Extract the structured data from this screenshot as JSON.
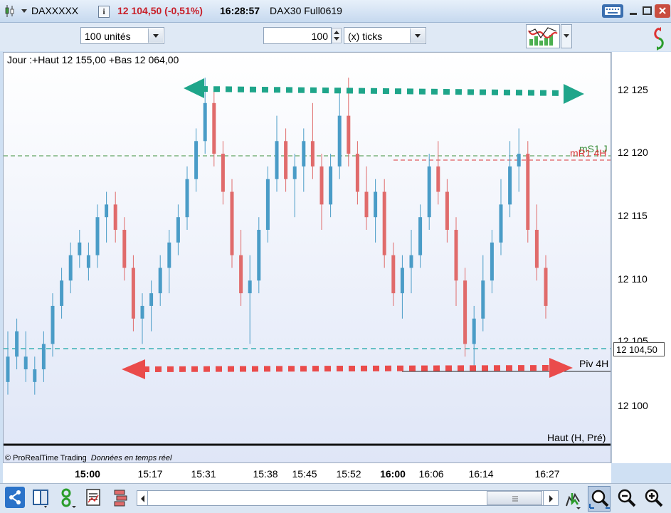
{
  "titlebar": {
    "symbol": "DAXXXXX",
    "info_icon": "i",
    "price_change": "12 104,50 (-0,51%)",
    "time": "16:28:57",
    "instrument": "DAX30 Full0619",
    "colors": {
      "price_change": "#c8202a"
    }
  },
  "toolbar": {
    "units_value": "100 unités",
    "ticks_value": "100",
    "ticks_unit": "(x) ticks"
  },
  "chart": {
    "header": "Jour :+Haut 12 155,00 +Bas 12 064,00",
    "copyright": "© ProRealTime Trading",
    "realtime_note": "Données en temps réel",
    "label_ms1": "mS1 J",
    "label_mr1": "mR1 4H",
    "label_piv": "Piv 4H",
    "label_haut": "Haut (H, Pré)",
    "current_price": "12 104,50",
    "price_axis_labels": [
      "12 125",
      "12 120",
      "12 115",
      "12 110",
      "12 105",
      "12 100"
    ],
    "time_axis_labels": [
      {
        "t": "15:00",
        "bold": true
      },
      {
        "t": "15:17",
        "bold": false
      },
      {
        "t": "15:31",
        "bold": false
      },
      {
        "t": "15:38",
        "bold": false
      },
      {
        "t": "15:45",
        "bold": false
      },
      {
        "t": "15:52",
        "bold": false
      },
      {
        "t": "16:00",
        "bold": true
      },
      {
        "t": "16:06",
        "bold": false
      },
      {
        "t": "16:14",
        "bold": false
      },
      {
        "t": "16:27",
        "bold": false
      }
    ],
    "colors": {
      "bull_candle": "#4a9cc7",
      "bear_candle": "#e06b6b",
      "green_line": "#3d8f3d",
      "red_line": "#d93636",
      "teal_line": "#19a6a6",
      "arrow_green": "#1fa58a",
      "arrow_red": "#ea4b4b"
    }
  },
  "bottombar": {
    "icons": [
      "share-icon",
      "layout-icon",
      "link-icon",
      "indicator-list-icon",
      "drawing-tools-icon",
      "scroll-left-icon",
      "scroll-thumb",
      "scroll-right-icon",
      "cursor-tool-icon",
      "zoom-select-icon",
      "zoom-out-icon",
      "zoom-in-icon"
    ]
  }
}
